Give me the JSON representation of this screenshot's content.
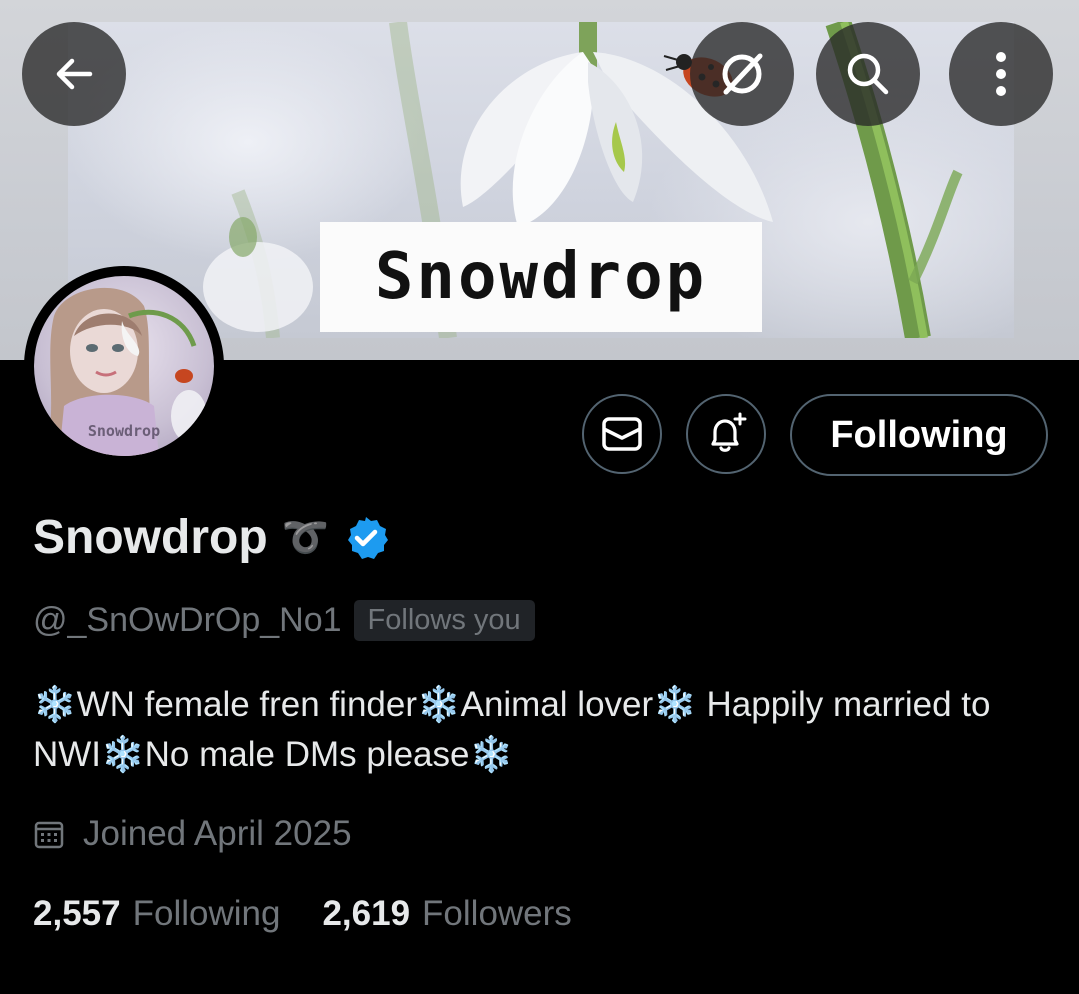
{
  "banner": {
    "label": "Snowdrop"
  },
  "avatar": {
    "label": "Snowdrop"
  },
  "top_bar": {
    "back_icon": "arrow-left-icon",
    "grok_icon": "grok-slash-circle-icon",
    "search_icon": "search-icon",
    "more_icon": "more-vertical-icon"
  },
  "actions": {
    "message_icon": "mail-icon",
    "notify_icon": "bell-plus-icon",
    "follow_label": "Following"
  },
  "profile": {
    "name": "Snowdrop",
    "name_emoji": "➰",
    "verified": true,
    "handle": "@_SnOwDrOp_No1",
    "follows_you": "Follows you",
    "bio_parts": [
      "❄️",
      "WN female fren finder",
      "❄️",
      "Animal lover",
      "❄️",
      " Happily married to NWI",
      "❄️",
      "No male DMs please",
      "❄️"
    ],
    "joined": "Joined April 2025",
    "following_count": "2,557",
    "following_label": "Following",
    "followers_count": "2,619",
    "followers_label": "Followers"
  },
  "colors": {
    "background": "#000000",
    "text_primary": "#e7e9ea",
    "text_secondary": "#71767b",
    "verified_blue": "#1d9bf0",
    "button_border": "#536471"
  }
}
